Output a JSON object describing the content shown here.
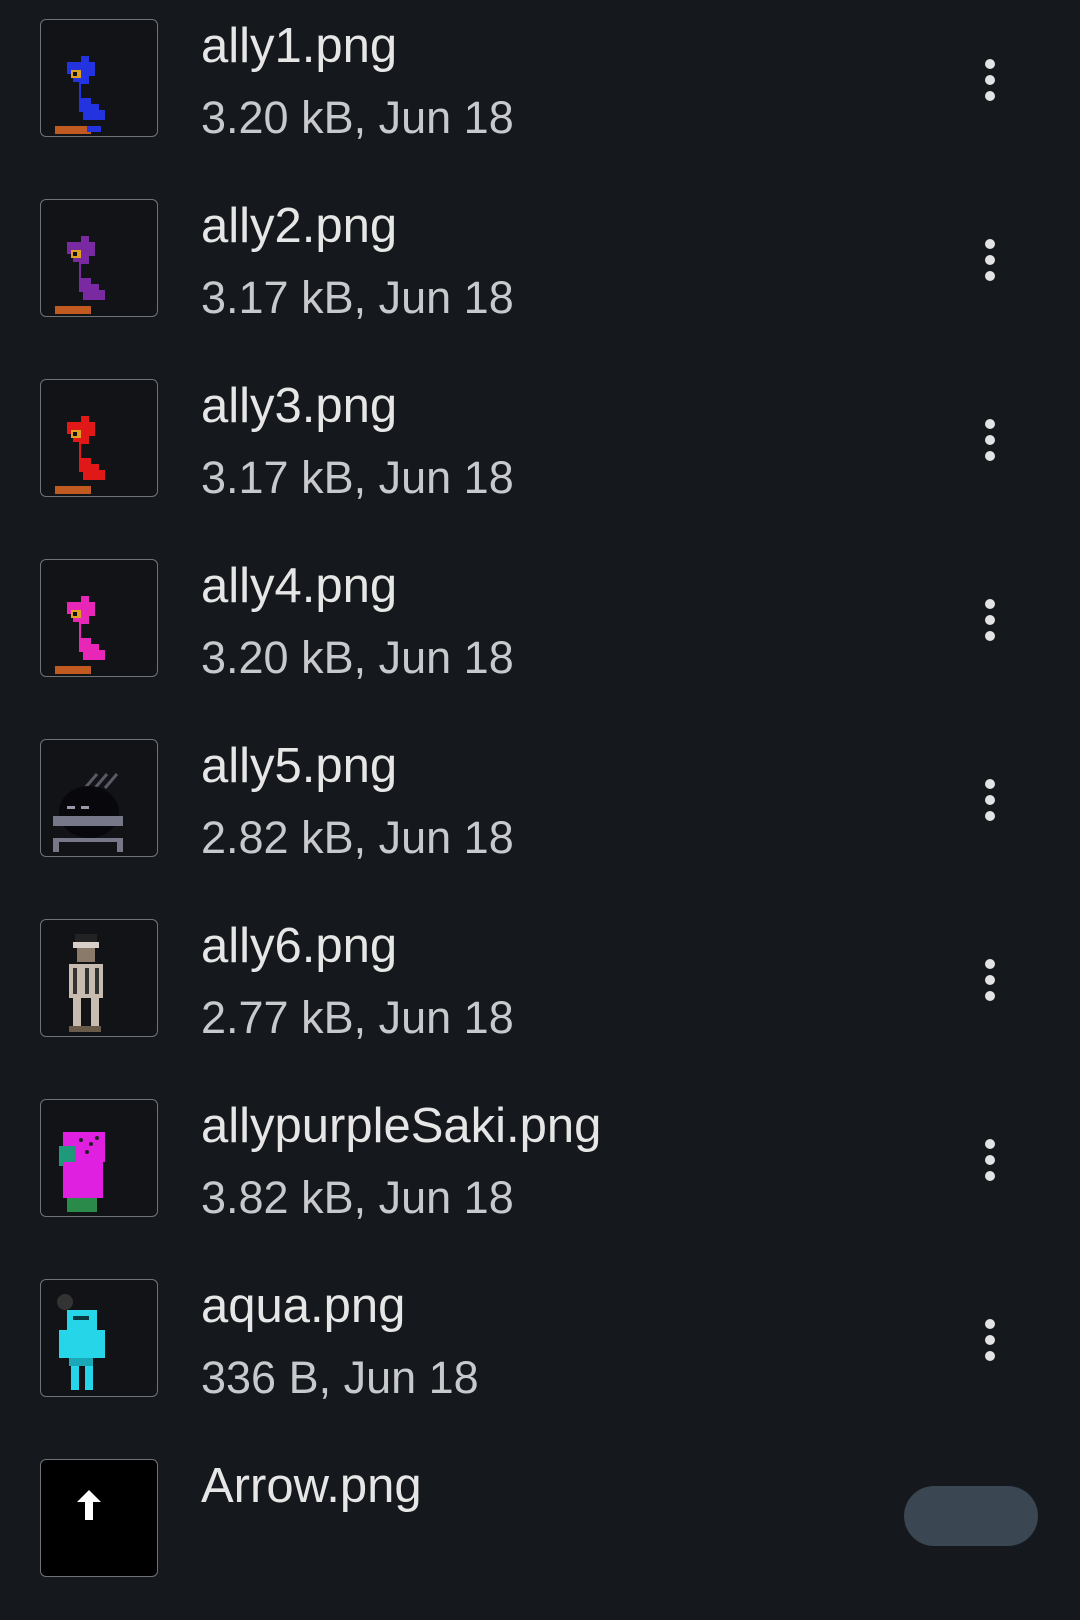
{
  "files": [
    {
      "name": "ally1.png",
      "meta": "3.20 kB, Jun 18",
      "thumb_icon": "blue-character-thumbnail",
      "accent": "#2433e0"
    },
    {
      "name": "ally2.png",
      "meta": "3.17 kB, Jun 18",
      "thumb_icon": "purple-character-thumbnail",
      "accent": "#7a2aa0"
    },
    {
      "name": "ally3.png",
      "meta": "3.17 kB, Jun 18",
      "thumb_icon": "red-character-thumbnail",
      "accent": "#e01818"
    },
    {
      "name": "ally4.png",
      "meta": "3.20 kB, Jun 18",
      "thumb_icon": "pink-character-thumbnail",
      "accent": "#e826b8"
    },
    {
      "name": "ally5.png",
      "meta": "2.82 kB, Jun 18",
      "thumb_icon": "dark-robot-thumbnail",
      "accent": "#6a6a78"
    },
    {
      "name": "ally6.png",
      "meta": "2.77 kB, Jun 18",
      "thumb_icon": "skeleton-character-thumbnail",
      "accent": "#a89a8a"
    },
    {
      "name": "allypurpleSaki.png",
      "meta": "3.82 kB, Jun 18",
      "thumb_icon": "magenta-character-thumbnail",
      "accent": "#e020e0"
    },
    {
      "name": "aqua.png",
      "meta": "336 B, Jun 18",
      "thumb_icon": "aqua-character-thumbnail",
      "accent": "#26d6e8"
    },
    {
      "name": "Arrow.png",
      "meta": "",
      "thumb_icon": "arrow-thumbnail",
      "accent": "#ffffff"
    }
  ],
  "more_icon": "more-vert-icon",
  "background": "#15181c"
}
